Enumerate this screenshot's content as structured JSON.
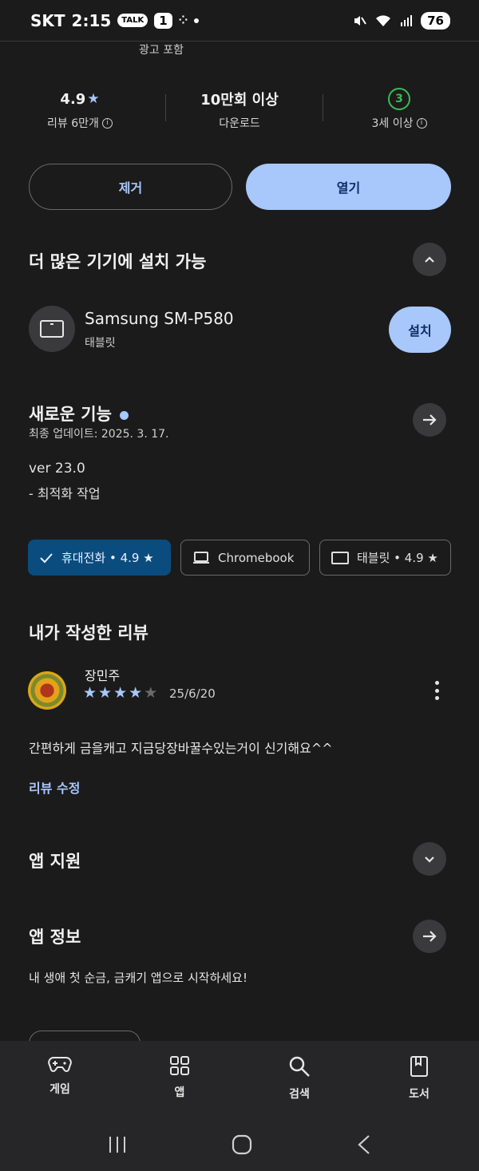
{
  "status_bar": {
    "carrier": "SKT",
    "time": "2:15",
    "talk_badge": "TALK",
    "notif_count": "1",
    "battery": "76"
  },
  "ad_text": "광고 포함",
  "stats": {
    "rating": "4.9",
    "reviews_label": "리뷰 6만개",
    "downloads": "10만회 이상",
    "downloads_label": "다운로드",
    "age_rating": "3",
    "age_label": "3세 이상"
  },
  "actions": {
    "remove_label": "제거",
    "open_label": "열기"
  },
  "more_devices": {
    "title": "더 많은 기기에 설치 가능",
    "device_name": "Samsung SM-P580",
    "device_type": "태블릿",
    "install_label": "설치"
  },
  "whats_new": {
    "title": "새로운 기능",
    "updated": "최종 업데이트: 2025. 3. 17.",
    "version": "ver 23.0",
    "note": "- 최적화 작업"
  },
  "chips": [
    {
      "label": "휴대전화 • 4.9 ★"
    },
    {
      "label": "Chromebook"
    },
    {
      "label": "태블릿 • 4.9 ★"
    }
  ],
  "my_review": {
    "title": "내가 작성한 리뷰",
    "reviewer": "장민주",
    "stars": 4,
    "max_stars": 5,
    "date": "25/6/20",
    "text": "간편하게 금을캐고 지금당장바꿀수있는거이 신기해요^^",
    "edit_label": "리뷰 수정"
  },
  "app_support": {
    "title": "앱 지원"
  },
  "app_info": {
    "title": "앱 정보",
    "text": "내 생애 첫 순금, 금캐기 앱으로 시작하세요!"
  },
  "bottom_nav": [
    {
      "label": "게임",
      "icon": "gamepad-icon"
    },
    {
      "label": "앱",
      "icon": "apps-grid-icon"
    },
    {
      "label": "검색",
      "icon": "search-icon"
    },
    {
      "label": "도서",
      "icon": "book-icon"
    }
  ],
  "colors": {
    "background": "#1b1b1c",
    "accent": "#a8c7fa",
    "active_chip": "#0a4c7e",
    "age_green": "#3cba54"
  }
}
